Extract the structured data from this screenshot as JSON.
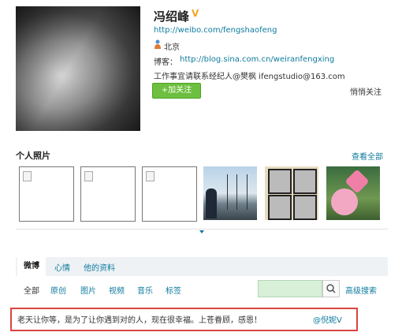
{
  "profile": {
    "name": "冯绍峰",
    "verified_mark": "V",
    "url": "http://weibo.com/fengshaofeng",
    "location": "北京",
    "blog_label": "博客：",
    "blog_url": "http://blog.sina.com.cn/weiranfengxing",
    "contact": "工作事宜请联系经纪人@樊枫 ifengstudio@163.com",
    "follow_button": "+加关注",
    "secret_follow": "悄悄关注"
  },
  "photos": {
    "title": "个人照片",
    "view_all": "查看全部"
  },
  "tabs": [
    "微博",
    "心情",
    "他的资料"
  ],
  "filters": [
    "全部",
    "原创",
    "图片",
    "视频",
    "音乐",
    "标签"
  ],
  "search": {
    "advanced": "高级搜索",
    "icon": "magnifier-icon"
  },
  "quote": {
    "text": "老天让你等，是为了让你遇到对的人，现在很幸福。上苍眷顾，感恩！",
    "mention": "@倪妮V"
  },
  "colors": {
    "link": "#0f7b9e",
    "follow_green": "#6dbf3f",
    "highlight_red": "#d9453f"
  }
}
